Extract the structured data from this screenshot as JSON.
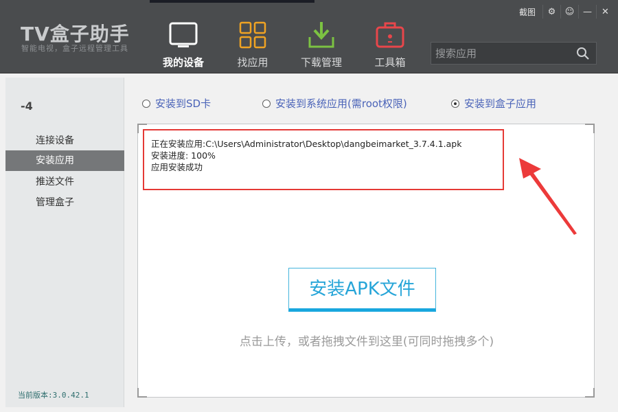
{
  "app": {
    "logo": "TV盒子助手",
    "subtitle": "智能电视，盒子远程管理工具"
  },
  "window": {
    "screenshot_label": "截图",
    "buttons": [
      "⚙",
      "☺",
      "—",
      "✕"
    ]
  },
  "nav": [
    {
      "label": "我的设备",
      "icon": "tv-icon",
      "active": true
    },
    {
      "label": "找应用",
      "icon": "apps-grid-icon",
      "active": false
    },
    {
      "label": "下载管理",
      "icon": "download-icon",
      "active": false
    },
    {
      "label": "工具箱",
      "icon": "toolbox-icon",
      "active": false
    }
  ],
  "search": {
    "placeholder": "搜索应用"
  },
  "sidebar": {
    "device": "-4",
    "items": [
      {
        "label": "连接设备",
        "active": false
      },
      {
        "label": "安装应用",
        "active": true
      },
      {
        "label": "推送文件",
        "active": false
      },
      {
        "label": "管理盒子",
        "active": false
      }
    ],
    "version": "当前版本:3.0.42.1"
  },
  "install_options": [
    {
      "label": "安装到SD卡",
      "selected": false
    },
    {
      "label": "安装到系统应用(需root权限)",
      "selected": false
    },
    {
      "label": "安装到盒子应用",
      "selected": true
    }
  ],
  "log": {
    "line1": "正在安装应用:C:\\Users\\Administrator\\Desktop\\dangbeimarket_3.7.4.1.apk",
    "line2": "安装进度:  100%",
    "line3": "应用安装成功"
  },
  "install_button": "安装APK文件",
  "hint": "点击上传，或者拖拽文件到这里(可同时拖拽多个)",
  "colors": {
    "header": "#4a4c4e",
    "accent_blue": "#26a5d8",
    "highlight_red": "#e53935",
    "option_text": "#4a63b8"
  }
}
